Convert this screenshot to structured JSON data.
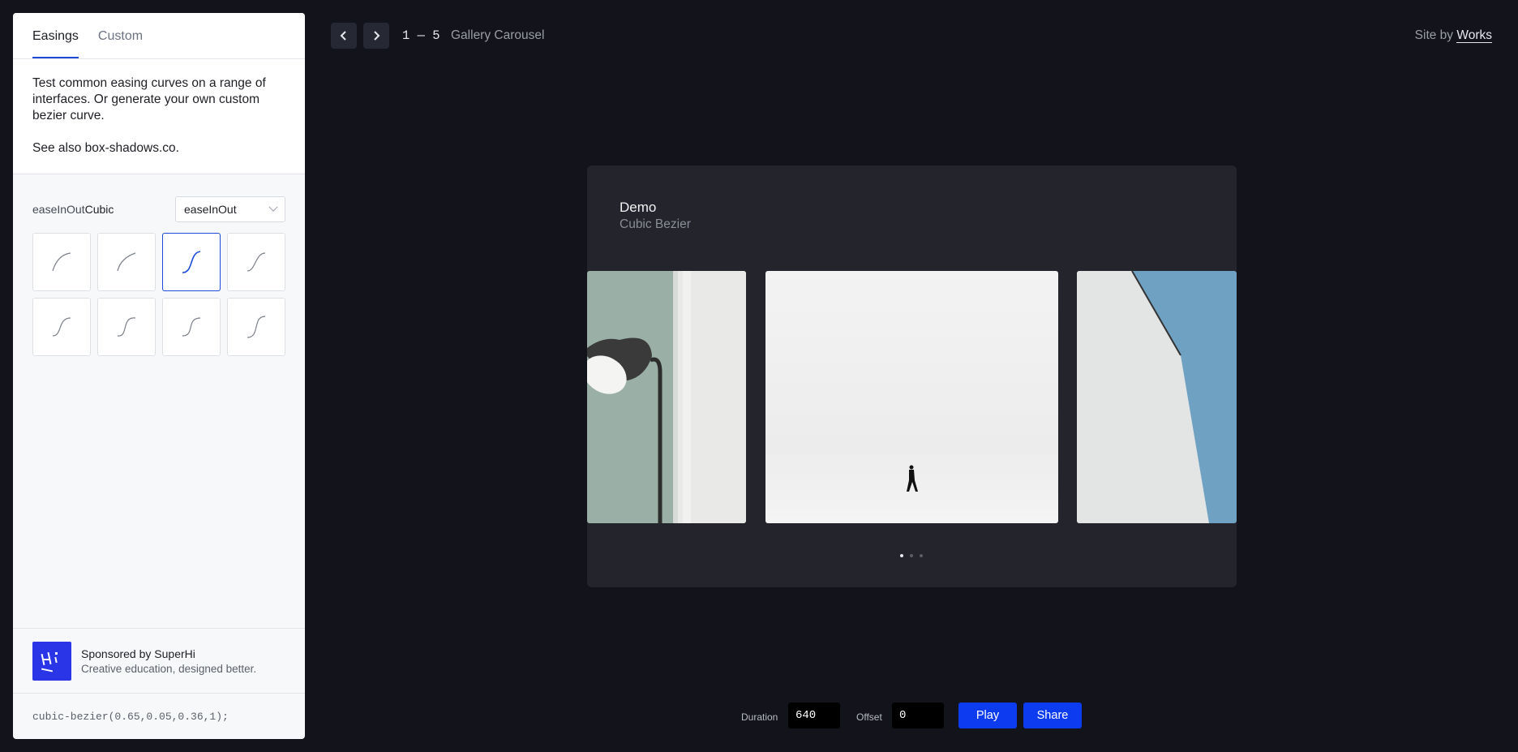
{
  "sidebar": {
    "tabs": [
      {
        "label": "Easings",
        "active": true
      },
      {
        "label": "Custom",
        "active": false
      }
    ],
    "intro": {
      "paragraph1": "Test common easing curves on a range of interfaces. Or generate your own custom bezier curve.",
      "paragraph2": "See also box-shadows.co."
    },
    "easing": {
      "label_prefix": "easeInOut",
      "label_suffix": "Cubic",
      "select_value": "easeInOut",
      "selected_index": 2,
      "curve_count": 8
    },
    "sponsor": {
      "title": "Sponsored by SuperHi",
      "subtitle": "Creative education, designed better."
    },
    "code": "cubic-bezier(0.65,0.05,0.36,1);"
  },
  "topbar": {
    "pager": "1 — 5",
    "title": "Gallery Carousel",
    "site_by_prefix": "Site by",
    "site_by_link": "Works"
  },
  "demo": {
    "title": "Demo",
    "subtitle": "Cubic Bezier",
    "dots": 3,
    "active_dot": 0
  },
  "controls": {
    "duration_label": "Duration",
    "duration_value": "640",
    "offset_label": "Offset",
    "offset_value": "0",
    "play_label": "Play",
    "share_label": "Share"
  },
  "colors": {
    "accent": "#1e4bd8",
    "button": "#0d3cf0",
    "background": "#12131b",
    "panel": "#23242c"
  }
}
